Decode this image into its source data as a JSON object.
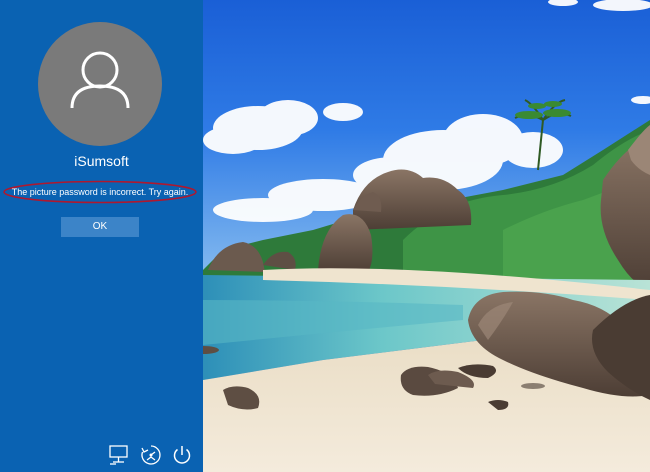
{
  "user": {
    "name": "iSumsoft",
    "avatar_icon": "user-icon"
  },
  "sign_in": {
    "error_message": "The picture password is incorrect. Try again.",
    "ok_label": "OK",
    "highlight_color": "#b0182e"
  },
  "bottom_bar": {
    "icons": [
      "network-icon",
      "ease-of-access-icon",
      "power-icon"
    ]
  },
  "colors": {
    "panel_background": "#0a62b2",
    "button_background": "#3c84c8",
    "avatar_background": "#7a7a7a"
  },
  "picture": {
    "description_icon": "beach-picture"
  }
}
